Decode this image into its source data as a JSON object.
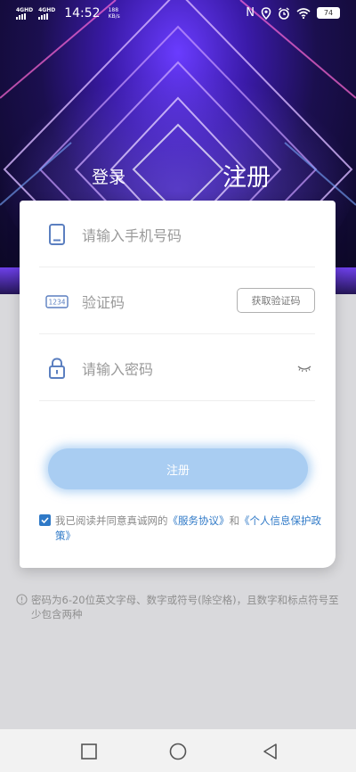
{
  "status_bar": {
    "network1": "4GHD",
    "network2": "4GHD",
    "time": "14:52",
    "speed_value": "188",
    "speed_unit": "KB/s",
    "nfc": "N",
    "battery": "74"
  },
  "tabs": {
    "login": "登录",
    "register": "注册"
  },
  "form": {
    "phone_placeholder": "请输入手机号码",
    "code_icon_text": "1234",
    "code_placeholder": "验证码",
    "get_code_button": "获取验证码",
    "password_placeholder": "请输入密码",
    "submit_label": "注册"
  },
  "agreement": {
    "prefix": "我已阅读并同意真诚网的",
    "service_link": "《服务协议》",
    "and": "和",
    "privacy_link": "《个人信息保护政策》"
  },
  "hint": "密码为6-20位英文字母、数字或符号(除空格)，且数字和标点符号至少包含两种",
  "colors": {
    "accent": "#2f79c7",
    "button": "#a9cdf2",
    "hero_top": "#6a3cff"
  }
}
